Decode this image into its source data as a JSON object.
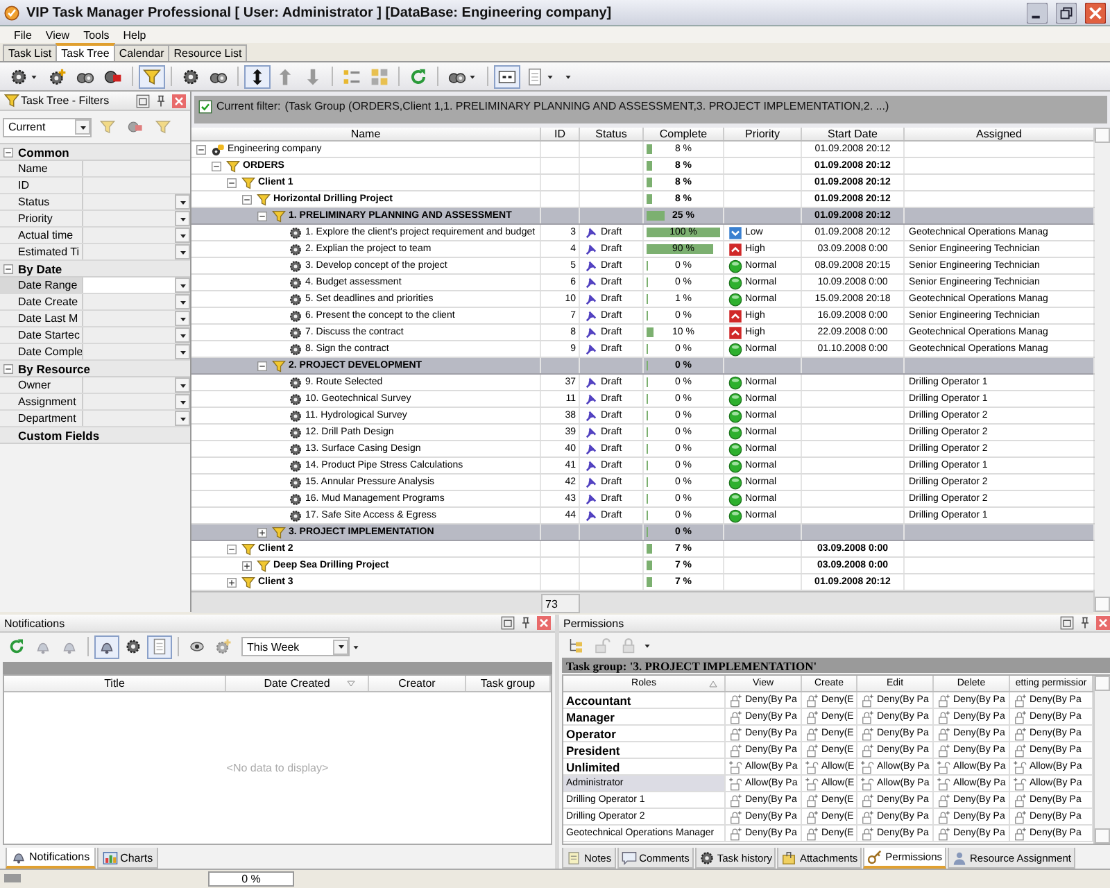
{
  "window": {
    "title": "VIP Task Manager Professional [ User: Administrator ] [DataBase: Engineering company]"
  },
  "menu": [
    "File",
    "View",
    "Tools",
    "Help"
  ],
  "tabs": [
    {
      "label": "Task List",
      "selected": false
    },
    {
      "label": "Task Tree",
      "selected": true
    },
    {
      "label": "Calendar",
      "selected": false
    },
    {
      "label": "Resource List",
      "selected": false
    }
  ],
  "toolbar": [
    {
      "kind": "gear",
      "pressed": false,
      "dropdown": true
    },
    {
      "kind": "gear-add",
      "pressed": false,
      "dropdown": false
    },
    {
      "kind": "gears",
      "pressed": false,
      "dropdown": false
    },
    {
      "kind": "gear-delete",
      "pressed": false,
      "dropdown": false
    },
    {
      "kind": "separator"
    },
    {
      "kind": "funnel",
      "pressed": true,
      "dropdown": false
    },
    {
      "kind": "separator"
    },
    {
      "kind": "gear",
      "pressed": false,
      "dropdown": false
    },
    {
      "kind": "gears",
      "pressed": false,
      "dropdown": false
    },
    {
      "kind": "separator"
    },
    {
      "kind": "move",
      "pressed": true,
      "dropdown": false
    },
    {
      "kind": "arrow-up",
      "pressed": false,
      "dropdown": false
    },
    {
      "kind": "arrow-down",
      "pressed": false,
      "dropdown": false
    },
    {
      "kind": "separator"
    },
    {
      "kind": "list",
      "pressed": false,
      "dropdown": false
    },
    {
      "kind": "grid",
      "pressed": false,
      "dropdown": false
    },
    {
      "kind": "separator"
    },
    {
      "kind": "refresh",
      "pressed": false,
      "dropdown": false
    },
    {
      "kind": "separator"
    },
    {
      "kind": "gears",
      "pressed": false,
      "dropdown": true
    },
    {
      "kind": "separator"
    },
    {
      "kind": "columns",
      "pressed": true,
      "dropdown": false
    },
    {
      "kind": "page",
      "pressed": false,
      "dropdown": true
    }
  ],
  "filter_panel": {
    "title": "Task Tree - Filters",
    "preset": "Current",
    "categories": [
      {
        "label": "Common",
        "expanded": true,
        "items": [
          {
            "label": "Name",
            "dropdown": false,
            "selected": false
          },
          {
            "label": "ID",
            "dropdown": false,
            "selected": false
          },
          {
            "label": "Status",
            "dropdown": true,
            "selected": false
          },
          {
            "label": "Priority",
            "dropdown": true,
            "selected": false
          },
          {
            "label": "Actual time",
            "dropdown": true,
            "selected": false
          },
          {
            "label": "Estimated Ti",
            "dropdown": true,
            "selected": false
          }
        ]
      },
      {
        "label": "By Date",
        "expanded": true,
        "items": [
          {
            "label": "Date Range",
            "dropdown": true,
            "selected": true
          },
          {
            "label": "Date Create",
            "dropdown": true,
            "selected": false
          },
          {
            "label": "Date Last M",
            "dropdown": true,
            "selected": false
          },
          {
            "label": "Date Startec",
            "dropdown": true,
            "selected": false
          },
          {
            "label": "Date Comple",
            "dropdown": true,
            "selected": false
          }
        ]
      },
      {
        "label": "By Resource",
        "expanded": true,
        "items": [
          {
            "label": "Owner",
            "dropdown": true,
            "selected": false
          },
          {
            "label": "Assignment",
            "dropdown": true,
            "selected": false
          },
          {
            "label": "Department",
            "dropdown": true,
            "selected": false
          }
        ]
      },
      {
        "label": "Custom Fields"
      }
    ]
  },
  "tree": {
    "filter": {
      "checked": true,
      "label": "Current filter:",
      "text": "(Task Group  (ORDERS,Client 1,1. PRELIMINARY PLANNING AND ASSESSMENT,3. PROJECT IMPLEMENTATION,2. ...)"
    },
    "columns": [
      "Name",
      "ID",
      "Status",
      "Complete",
      "Priority",
      "Start Date",
      "Assigned"
    ],
    "rows": [
      {
        "kind": "company",
        "name": "Engineering company",
        "complete": "8 %",
        "level": 0.08,
        "start": "01.09.2008 20:12",
        "expanded": true,
        "children": [
          {
            "kind": "folder",
            "name": "ORDERS",
            "complete": "8 %",
            "level": 0.08,
            "start": "01.09.2008 20:12",
            "expanded": true,
            "children": [
              {
                "kind": "folder",
                "name": "Client 1",
                "complete": "8 %",
                "level": 0.08,
                "start": "01.09.2008 20:12",
                "expanded": true,
                "children": [
                  {
                    "kind": "folder",
                    "name": "Horizontal Drilling Project",
                    "complete": "8 %",
                    "level": 0.08,
                    "start": "01.09.2008 20:12",
                    "expanded": true,
                    "children": [
                      {
                        "kind": "phase",
                        "name": "1. PRELIMINARY PLANNING AND ASSESSMENT",
                        "complete": "25 %",
                        "level": 0.25,
                        "start": "01.09.2008 20:12",
                        "expanded": true,
                        "children": [
                          {
                            "kind": "task",
                            "name": "1. Explore the client's project requirement and budget",
                            "id": "3",
                            "status": "Draft",
                            "complete": "100 %",
                            "level": 1,
                            "priority": {
                              "label": "Low",
                              "kind": "low"
                            },
                            "start": "01.09.2008 20:12",
                            "assigned": "Geotechnical Operations Manag"
                          },
                          {
                            "kind": "task",
                            "name": "2. Explian the project to team",
                            "id": "4",
                            "status": "Draft",
                            "complete": "90 %",
                            "level": 0.9,
                            "priority": {
                              "label": "High",
                              "kind": "high"
                            },
                            "start": "03.09.2008 0:00",
                            "assigned": "Senior Engineering Technician"
                          },
                          {
                            "kind": "task",
                            "name": "3. Develop concept of the project",
                            "id": "5",
                            "status": "Draft",
                            "complete": "0 %",
                            "level": 0,
                            "priority": {
                              "label": "Normal",
                              "kind": "normal"
                            },
                            "start": "08.09.2008 20:15",
                            "assigned": "Senior Engineering Technician"
                          },
                          {
                            "kind": "task",
                            "name": "4. Budget assessment",
                            "id": "6",
                            "status": "Draft",
                            "complete": "0 %",
                            "level": 0,
                            "priority": {
                              "label": "Normal",
                              "kind": "normal"
                            },
                            "start": "10.09.2008 0:00",
                            "assigned": "Senior Engineering Technician"
                          },
                          {
                            "kind": "task",
                            "name": "5. Set deadlines and priorities",
                            "id": "10",
                            "status": "Draft",
                            "complete": "1 %",
                            "level": 0.01,
                            "priority": {
                              "label": "Normal",
                              "kind": "normal"
                            },
                            "start": "15.09.2008 20:18",
                            "assigned": "Geotechnical Operations Manag"
                          },
                          {
                            "kind": "task",
                            "name": "6. Present the concept to the client",
                            "id": "7",
                            "status": "Draft",
                            "complete": "0 %",
                            "level": 0,
                            "priority": {
                              "label": "High",
                              "kind": "high"
                            },
                            "start": "16.09.2008 0:00",
                            "assigned": "Senior Engineering Technician"
                          },
                          {
                            "kind": "task",
                            "name": "7. Discuss the contract",
                            "id": "8",
                            "status": "Draft",
                            "complete": "10 %",
                            "level": 0.1,
                            "priority": {
                              "label": "High",
                              "kind": "high"
                            },
                            "start": "22.09.2008 0:00",
                            "assigned": "Geotechnical Operations Manag"
                          },
                          {
                            "kind": "task",
                            "name": "8. Sign the contract",
                            "id": "9",
                            "status": "Draft",
                            "complete": "0 %",
                            "level": 0,
                            "priority": {
                              "label": "Normal",
                              "kind": "normal"
                            },
                            "start": "01.10.2008 0:00",
                            "assigned": "Geotechnical Operations Manag"
                          }
                        ]
                      },
                      {
                        "kind": "phase",
                        "name": "2. PROJECT DEVELOPMENT",
                        "complete": "0 %",
                        "level": 0,
                        "expanded": true,
                        "children": [
                          {
                            "kind": "task",
                            "name": "9. Route Selected",
                            "id": "37",
                            "status": "Draft",
                            "complete": "0 %",
                            "level": 0,
                            "priority": {
                              "label": "Normal",
                              "kind": "normal"
                            },
                            "assigned": "Drilling Operator 1"
                          },
                          {
                            "kind": "task",
                            "name": "10. Geotechnical Survey",
                            "id": "11",
                            "status": "Draft",
                            "complete": "0 %",
                            "level": 0,
                            "priority": {
                              "label": "Normal",
                              "kind": "normal"
                            },
                            "assigned": "Drilling Operator 1"
                          },
                          {
                            "kind": "task",
                            "name": "11. Hydrological Survey",
                            "id": "38",
                            "status": "Draft",
                            "complete": "0 %",
                            "level": 0,
                            "priority": {
                              "label": "Normal",
                              "kind": "normal"
                            },
                            "assigned": "Drilling Operator 2"
                          },
                          {
                            "kind": "task",
                            "name": "12. Drill Path Design",
                            "id": "39",
                            "status": "Draft",
                            "complete": "0 %",
                            "level": 0,
                            "priority": {
                              "label": "Normal",
                              "kind": "normal"
                            },
                            "assigned": "Drilling Operator 2"
                          },
                          {
                            "kind": "task",
                            "name": "13. Surface Casing Design",
                            "id": "40",
                            "status": "Draft",
                            "complete": "0 %",
                            "level": 0,
                            "priority": {
                              "label": "Normal",
                              "kind": "normal"
                            },
                            "assigned": "Drilling Operator 2"
                          },
                          {
                            "kind": "task",
                            "name": "14. Product Pipe Stress Calculations",
                            "id": "41",
                            "status": "Draft",
                            "complete": "0 %",
                            "level": 0,
                            "priority": {
                              "label": "Normal",
                              "kind": "normal"
                            },
                            "assigned": "Drilling Operator 1"
                          },
                          {
                            "kind": "task",
                            "name": "15. Annular Pressure Analysis",
                            "id": "42",
                            "status": "Draft",
                            "complete": "0 %",
                            "level": 0,
                            "priority": {
                              "label": "Normal",
                              "kind": "normal"
                            },
                            "assigned": "Drilling Operator 2"
                          },
                          {
                            "kind": "task",
                            "name": "16. Mud Management Programs",
                            "id": "43",
                            "status": "Draft",
                            "complete": "0 %",
                            "level": 0,
                            "priority": {
                              "label": "Normal",
                              "kind": "normal"
                            },
                            "assigned": "Drilling Operator 2"
                          },
                          {
                            "kind": "task",
                            "name": "17. Safe Site Access & Egress",
                            "id": "44",
                            "status": "Draft",
                            "complete": "0 %",
                            "level": 0,
                            "priority": {
                              "label": "Normal",
                              "kind": "normal"
                            },
                            "assigned": "Drilling Operator 1"
                          }
                        ]
                      },
                      {
                        "kind": "phase",
                        "name": "3. PROJECT IMPLEMENTATION",
                        "complete": "0 %",
                        "level": 0,
                        "expanded": false
                      }
                    ]
                  }
                ]
              },
              {
                "kind": "folder",
                "name": "Client 2",
                "complete": "7 %",
                "level": 0.07,
                "start": "03.09.2008 0:00",
                "expanded": true,
                "children": [
                  {
                    "kind": "folder",
                    "name": "Deep Sea Drilling Project",
                    "complete": "7 %",
                    "level": 0.07,
                    "start": "03.09.2008 0:00",
                    "expanded": false
                  }
                ]
              },
              {
                "kind": "folder",
                "name": "Client 3",
                "complete": "7 %",
                "level": 0.07,
                "start": "01.09.2008 20:12",
                "expanded": false
              }
            ]
          }
        ]
      }
    ],
    "footer_count": "73"
  },
  "notifications": {
    "title": "Notifications",
    "period": "This Week",
    "columns": [
      "Title",
      "Date Created",
      "Creator",
      "Task group"
    ],
    "empty_text": "<No data to display>",
    "tabs": [
      {
        "label": "Notifications",
        "kind": "bell",
        "selected": true
      },
      {
        "label": "Charts",
        "kind": "chart",
        "selected": false
      }
    ]
  },
  "permissions": {
    "title": "Permissions",
    "caption": "Task group: '3. PROJECT IMPLEMENTATION'",
    "columns": [
      "Roles",
      "View",
      "Create",
      "Edit",
      "Delete",
      "etting permissior"
    ],
    "rows": [
      {
        "kind": "role",
        "locked": true,
        "selected": false,
        "cells": [
          "Accountant",
          "Deny(By Pa",
          "Deny(E",
          "Deny(By Pa",
          "Deny(By Pa",
          "Deny(By Pa"
        ]
      },
      {
        "kind": "role",
        "locked": true,
        "selected": false,
        "cells": [
          "Manager",
          "Deny(By Pa",
          "Deny(E",
          "Deny(By Pa",
          "Deny(By Pa",
          "Deny(By Pa"
        ]
      },
      {
        "kind": "role",
        "locked": true,
        "selected": false,
        "cells": [
          "Operator",
          "Deny(By Pa",
          "Deny(E",
          "Deny(By Pa",
          "Deny(By Pa",
          "Deny(By Pa"
        ]
      },
      {
        "kind": "role",
        "locked": true,
        "selected": false,
        "cells": [
          "President",
          "Deny(By Pa",
          "Deny(E",
          "Deny(By Pa",
          "Deny(By Pa",
          "Deny(By Pa"
        ]
      },
      {
        "kind": "role",
        "locked": false,
        "selected": false,
        "cells": [
          "Unlimited",
          "Allow(By Pa",
          "Allow(E",
          "Allow(By Pa",
          "Allow(By Pa",
          "Allow(By Pa"
        ]
      },
      {
        "kind": "user",
        "locked": false,
        "selected": true,
        "cells": [
          "Administrator",
          "Allow(By Pa",
          "Allow(E",
          "Allow(By Pa",
          "Allow(By Pa",
          "Allow(By Pa"
        ]
      },
      {
        "kind": "user",
        "locked": true,
        "selected": false,
        "cells": [
          "Drilling Operator 1",
          "Deny(By Pa",
          "Deny(E",
          "Deny(By Pa",
          "Deny(By Pa",
          "Deny(By Pa"
        ]
      },
      {
        "kind": "user",
        "locked": true,
        "selected": false,
        "cells": [
          "Drilling Operator 2",
          "Deny(By Pa",
          "Deny(E",
          "Deny(By Pa",
          "Deny(By Pa",
          "Deny(By Pa"
        ]
      },
      {
        "kind": "user",
        "locked": true,
        "selected": false,
        "cells": [
          "Geotechnical Operations Manager",
          "Deny(By Pa",
          "Deny(E",
          "Deny(By Pa",
          "Deny(By Pa",
          "Deny(By Pa"
        ]
      }
    ],
    "tabs": [
      {
        "label": "Notes",
        "kind": "note",
        "selected": false
      },
      {
        "label": "Comments",
        "kind": "comment",
        "selected": false
      },
      {
        "label": "Task history",
        "kind": "gear",
        "selected": false
      },
      {
        "label": "Attachments",
        "kind": "clip",
        "selected": false
      },
      {
        "label": "Permissions",
        "kind": "key",
        "selected": true
      },
      {
        "label": "Resource Assignment",
        "kind": "person",
        "selected": false
      }
    ]
  },
  "status_bar": {
    "progress": "0 %"
  }
}
